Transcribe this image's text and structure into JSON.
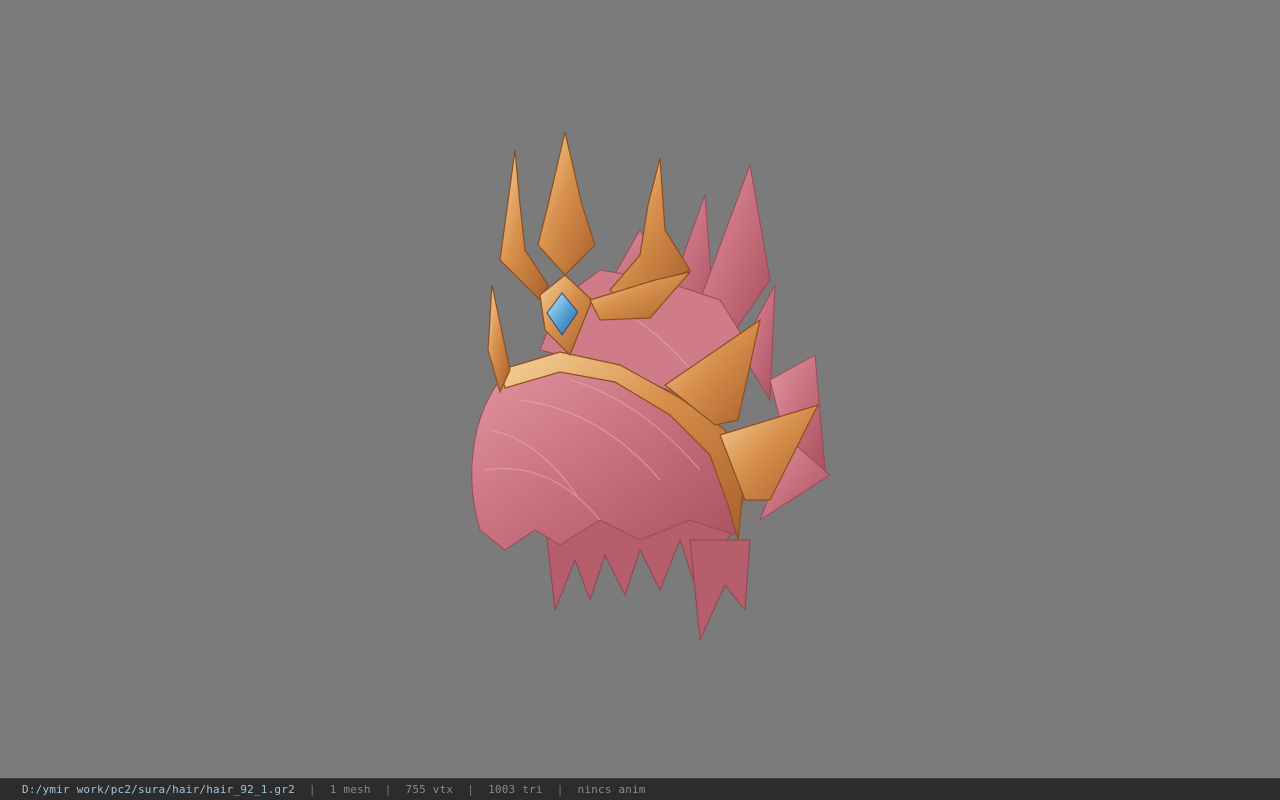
{
  "status_bar": {
    "file_path": "D:/ymir work/pc2/sura/hair/hair_92_1.gr2",
    "separator": "|",
    "mesh_count": "1 mesh",
    "vertex_count": "755 vtx",
    "triangle_count": "1003 tri",
    "animation": "nincs anim"
  },
  "viewport": {
    "background_color": "#7b7b7b",
    "model_hair_color": "#c8707e",
    "model_crown_color": "#d99a55",
    "model_gem_color": "#5aa6d6"
  }
}
